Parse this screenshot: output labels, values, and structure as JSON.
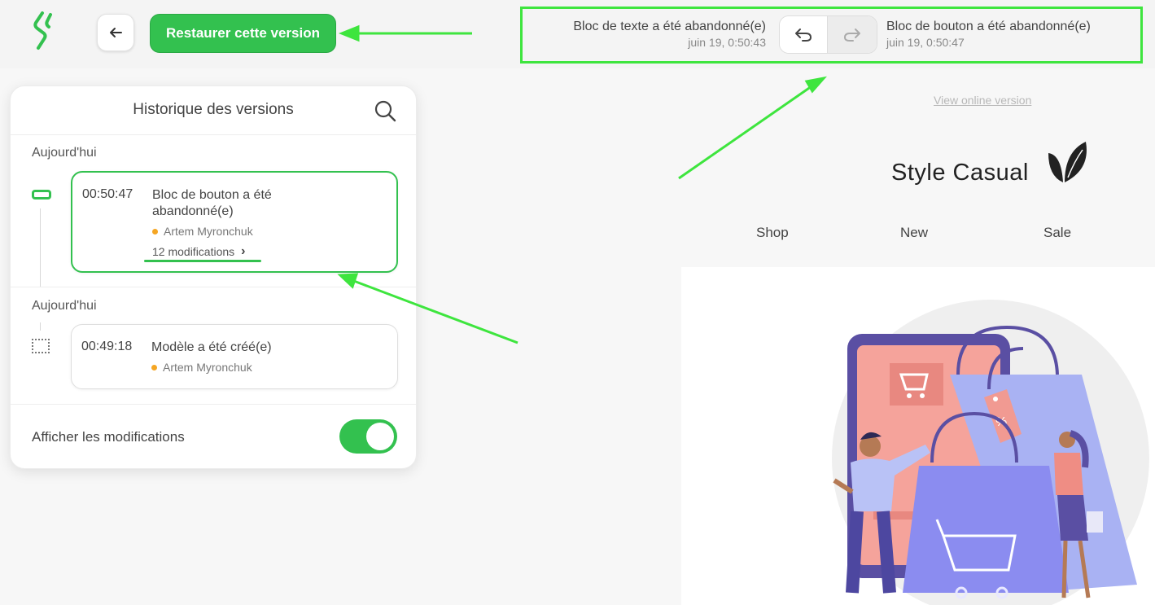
{
  "toolbar": {
    "back_icon": "arrow-left-icon",
    "restore_label": "Restaurer cette version"
  },
  "history_nav": {
    "prev": {
      "title": "Bloc de texte a été abandonné(e)",
      "time": "juin 19, 0:50:43"
    },
    "next": {
      "title": "Bloc de bouton a été abandonné(e)",
      "time": "juin 19, 0:50:47"
    },
    "undo_icon": "undo-icon",
    "redo_icon": "redo-icon"
  },
  "panel": {
    "title": "Historique des versions",
    "search_icon": "search-icon",
    "groups": [
      {
        "label": "Aujourd'hui",
        "entry": {
          "time": "00:50:47",
          "title": "Bloc de bouton a été abandonné(e)",
          "user": "Artem Myronchuk",
          "modifications": "12 modifications",
          "icon": "button-block-icon"
        }
      },
      {
        "label": "Aujourd'hui",
        "entry": {
          "time": "00:49:18",
          "title": "Modèle a été créé(e)",
          "user": "Artem Myronchuk",
          "icon": "template-icon"
        }
      }
    ],
    "show_changes_label": "Afficher les modifications",
    "show_changes_on": true
  },
  "preview": {
    "view_online": "View online version",
    "brand": "Style Casual",
    "menu": [
      "Shop",
      "New",
      "Sale"
    ]
  },
  "colors": {
    "accent": "#33c14f",
    "annotation": "#3ee53e",
    "user_dot": "#f5a623"
  }
}
